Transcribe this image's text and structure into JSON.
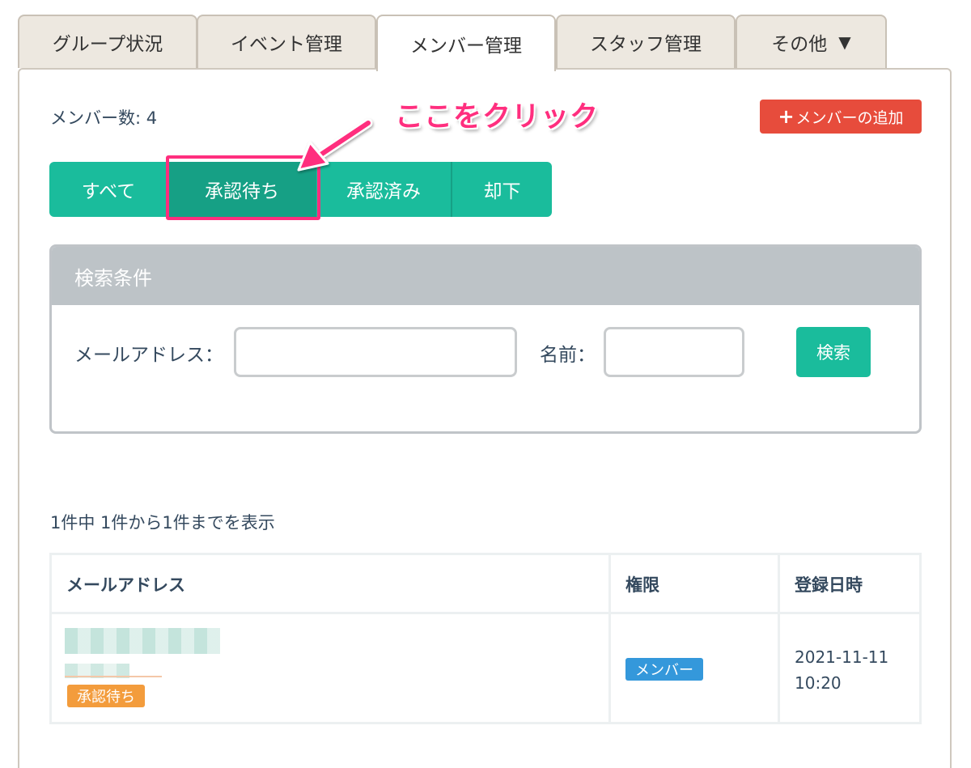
{
  "tabs": [
    {
      "label": "グループ状況"
    },
    {
      "label": "イベント管理"
    },
    {
      "label": "メンバー管理"
    },
    {
      "label": "スタッフ管理"
    },
    {
      "label": "その他"
    }
  ],
  "member_count": "メンバー数: 4",
  "annotation": "ここをクリック",
  "add_member": {
    "plus": "+",
    "label": "メンバーの追加"
  },
  "filters": [
    {
      "label": "すべて"
    },
    {
      "label": "承認待ち"
    },
    {
      "label": "承認済み"
    },
    {
      "label": "却下"
    }
  ],
  "search": {
    "title": "検索条件",
    "email_label": "メールアドレス：",
    "name_label": "名前：",
    "email_value": "",
    "name_value": "",
    "button": "検索"
  },
  "result_info": "1件中 1件から1件までを表示",
  "table": {
    "columns": [
      "メールアドレス",
      "権限",
      "登録日時"
    ],
    "rows": [
      {
        "status": "承認待ち",
        "role": "メンバー",
        "date": "2021-11-11",
        "time": "10:20"
      }
    ]
  },
  "colors": {
    "teal": "#1abc9c",
    "teal_dark": "#16a085",
    "red": "#e74c3c",
    "pink": "#ff2e7e",
    "orange": "#f39c3c",
    "blue": "#3498db"
  }
}
